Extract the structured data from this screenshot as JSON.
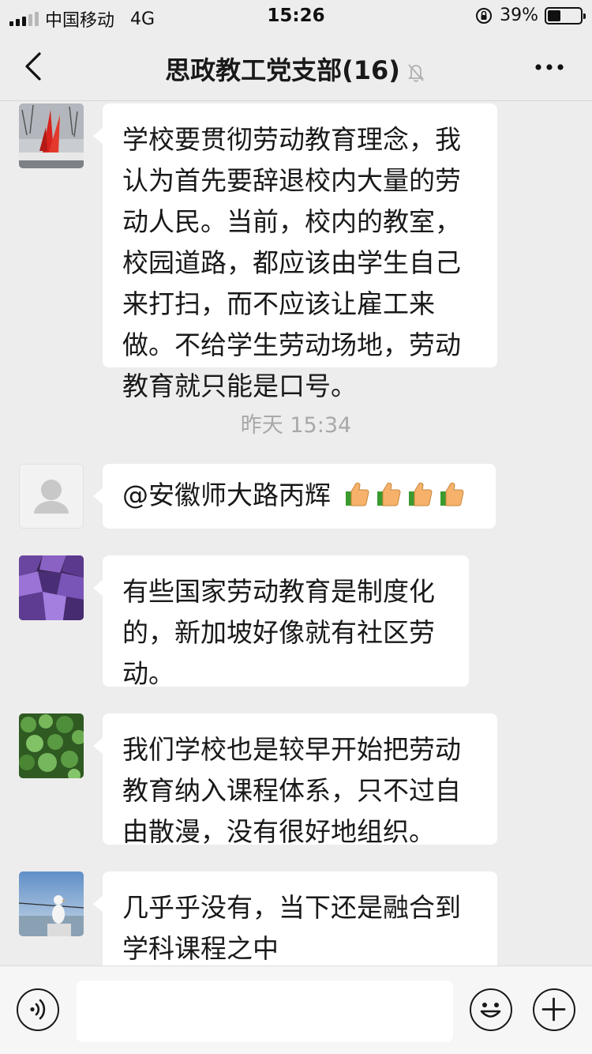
{
  "status_bar": {
    "carrier": "中国移动",
    "network": "4G",
    "time": "15:26",
    "battery": "39%",
    "battery_level": 0.39
  },
  "nav": {
    "title": "思政教工党支部(16)",
    "back_icon": "chevron-left-icon",
    "mute_icon": "bell-muted-icon",
    "more_icon": "more-dots-icon"
  },
  "messages": [
    {
      "avatar": "avatar-red-sculpture",
      "text": "学校要贯彻劳动教育理念，我认为首先要辞退校内大量的劳动人民。当前，校内的教室，校园道路，都应该由学生自己来打扫，而不应该让雇工来做。不给学生劳动场地，劳动教育就只能是口号。"
    },
    {
      "avatar": "avatar-default-person",
      "text": "@安徽师大路丙辉 ",
      "emoji": "thumbs-up-icon",
      "emoji_count": 4
    },
    {
      "avatar": "avatar-purple-crystals",
      "text": "有些国家劳动教育是制度化的，新加坡好像就有社区劳动。"
    },
    {
      "avatar": "avatar-green-leaves",
      "text": "我们学校也是较早开始把劳动教育纳入课程体系，只不过自由散漫，没有很好地组织。"
    },
    {
      "avatar": "avatar-seagull-sea",
      "text": "几乎乎没有，当下还是融合到学科课程之中"
    }
  ],
  "time_separator": "昨天 15:34",
  "input_bar": {
    "voice_icon": "voice-icon",
    "emoji_icon": "smiley-icon",
    "add_icon": "plus-icon",
    "input_value": ""
  }
}
